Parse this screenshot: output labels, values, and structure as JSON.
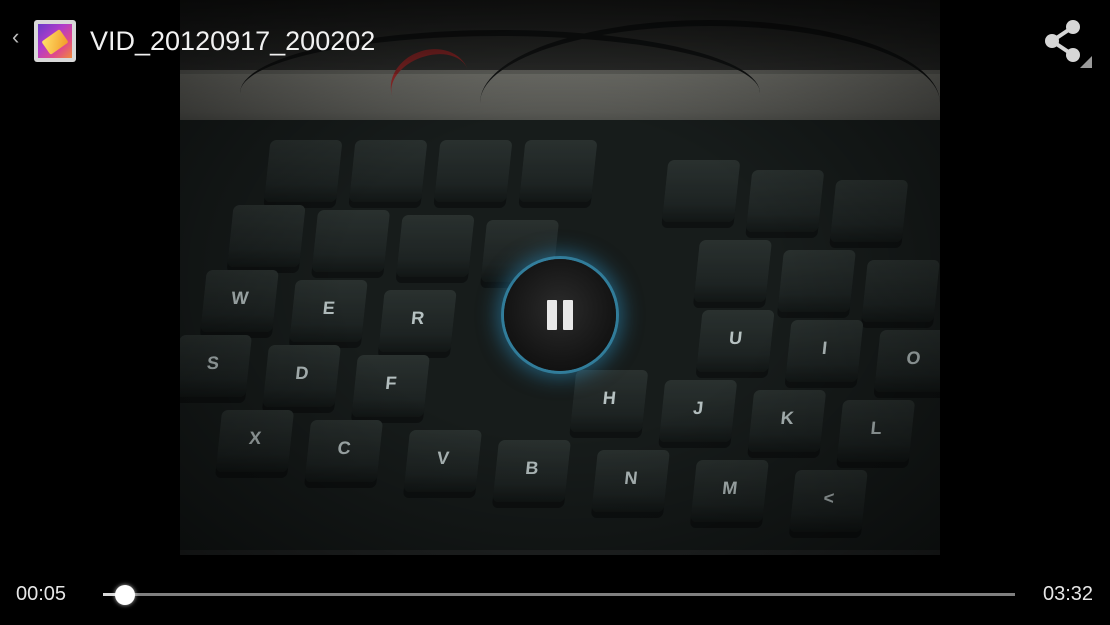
{
  "header": {
    "back_label": "‹",
    "app_icon": "gallery-icon",
    "title": "VID_20120917_200202",
    "share_icon": "share-icon"
  },
  "player": {
    "state_icon": "pause-icon",
    "current_time": "00:05",
    "total_time": "03:32",
    "progress": 0.024
  },
  "colors": {
    "background": "#000000",
    "text": "#f1f1f1",
    "glow": "#2d96c8",
    "track": "#7f7f7f",
    "thumb": "#ffffff"
  }
}
